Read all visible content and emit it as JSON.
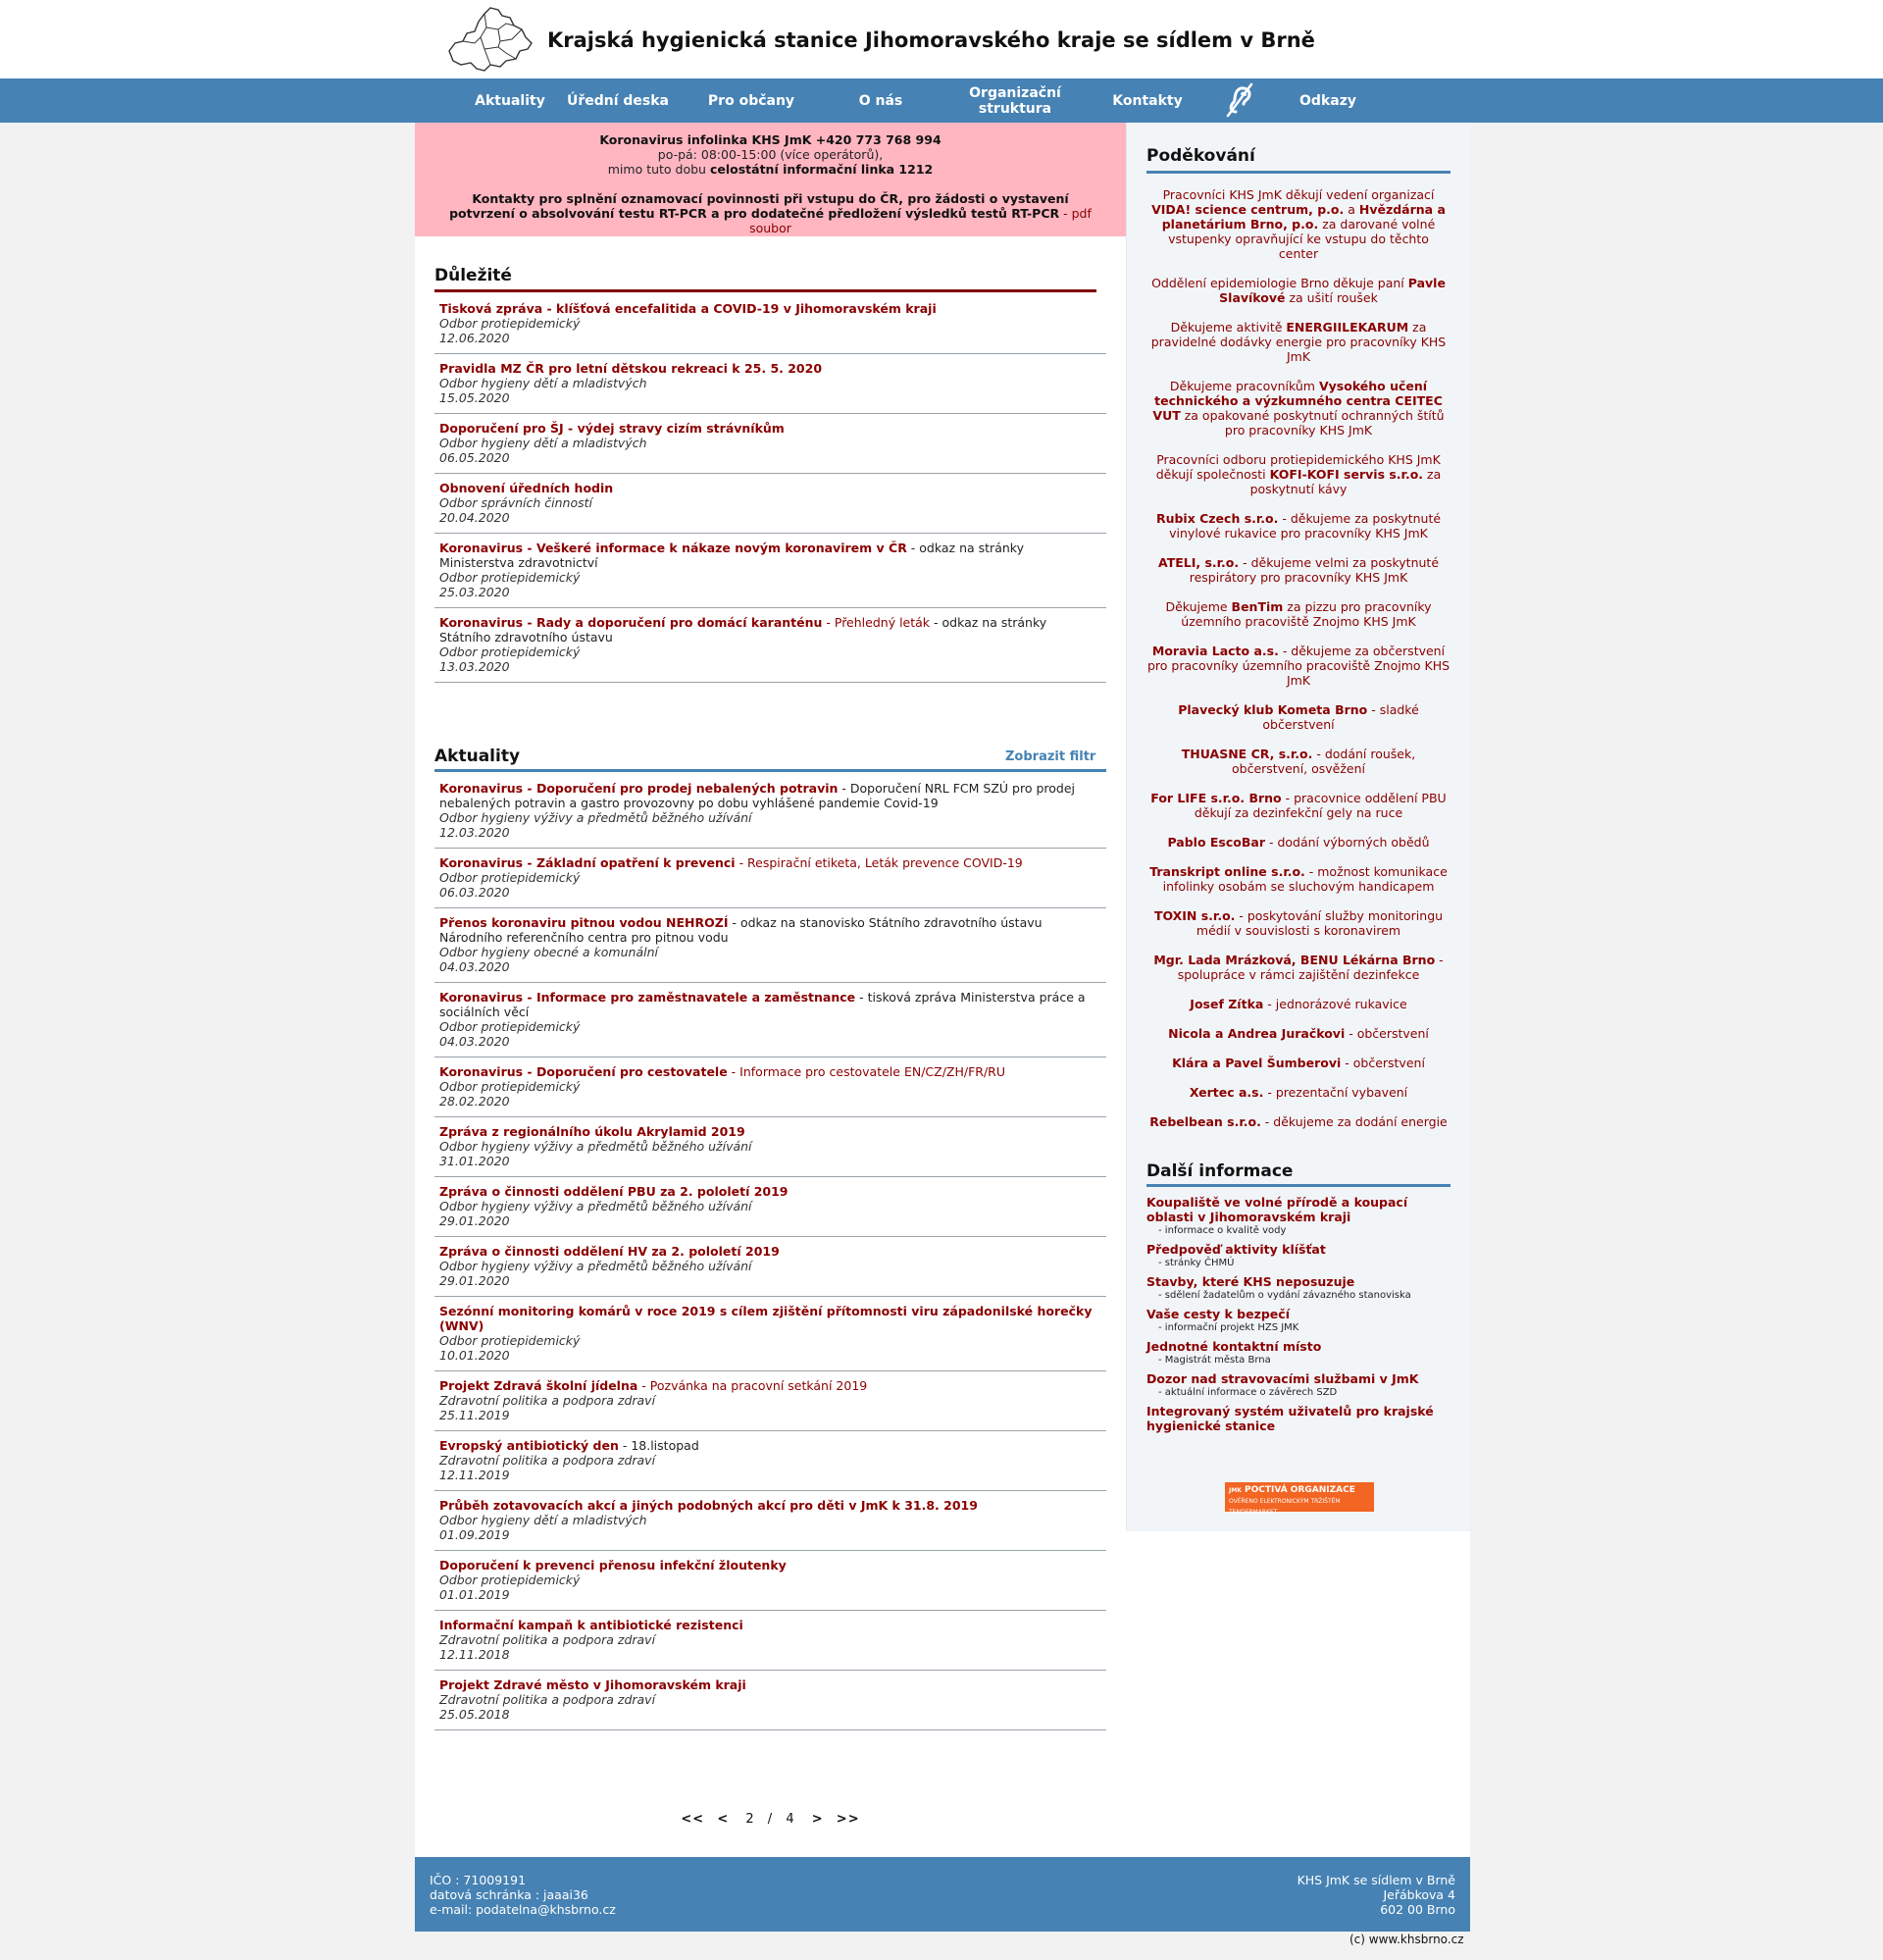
{
  "header": {
    "title": "Krajská hygienická stanice Jihomoravského kraje se sídlem v Brně",
    "logo_icon": "jmk-region-map-icon"
  },
  "nav": {
    "items": [
      {
        "label": "Aktuality"
      },
      {
        "label": "Úřední deska"
      },
      {
        "label": "Pro občany"
      },
      {
        "label": "O nás"
      },
      {
        "label": "Organizační struktura"
      },
      {
        "label": "Kontakty"
      },
      {
        "label": "Odkazy"
      }
    ],
    "hearing_icon": "hearing-aid-icon"
  },
  "alert": {
    "line1": "Koronavirus infolinka KHS JmK +420 773 768 994",
    "line2": "po-pá: 08:00-15:00 (více operátorů),",
    "line3_prefix": "mimo tuto dobu ",
    "line3_bold": "celostátní informační linka 1212",
    "contacts_bold": "Kontakty pro splnění oznamovací povinnosti při vstupu do ČR, pro žádosti o vystavení potvrzení o absolvování testu RT-PCR a pro dodatečné předložení výsledků testů RT-PCR",
    "contacts_link": " - pdf soubor"
  },
  "important": {
    "title": "Důležité",
    "items": [
      {
        "title": "Tisková zpráva - klíšťová encefalitida a COVID-19 v Jihomoravském kraji",
        "extra": "",
        "desc": "",
        "dept": "Odbor protiepidemický",
        "date": "12.06.2020"
      },
      {
        "title": "Pravidla MZ ČR pro letní dětskou rekreaci k 25. 5. 2020",
        "extra": "",
        "desc": "",
        "dept": "Odbor hygieny dětí a mladistvých",
        "date": "15.05.2020"
      },
      {
        "title": "Doporučení pro ŠJ - výdej stravy cizím strávníkům",
        "extra": "",
        "desc": "",
        "dept": "Odbor hygieny dětí a mladistvých",
        "date": "06.05.2020"
      },
      {
        "title": "Obnovení úředních hodin",
        "extra": "",
        "desc": "",
        "dept": "Odbor správních činností",
        "date": "20.04.2020"
      },
      {
        "title": "Koronavirus - Veškeré informace k nákaze novým koronavirem v ČR",
        "extra": "",
        "desc": " - odkaz na stránky Ministerstva zdravotnictví",
        "dept": "Odbor protiepidemický",
        "date": "25.03.2020"
      },
      {
        "title": "Koronavirus - Rady a doporučení pro domácí karanténu",
        "extra": " - Přehledný leták",
        "desc": " - odkaz na stránky Státního zdravotního ústavu",
        "dept": "Odbor protiepidemický",
        "date": "13.03.2020"
      }
    ]
  },
  "news": {
    "title": "Aktuality",
    "filter_label": "Zobrazit filtr",
    "items": [
      {
        "title": "Koronavirus - Doporučení pro prodej nebalených potravin",
        "extra": "",
        "desc": " - Doporučení NRL FCM SZÚ pro prodej nebalených potravin a gastro provozovny po dobu vyhlášené pandemie Covid-19",
        "dept": "Odbor hygieny výživy a předmětů běžného užívání",
        "date": "12.03.2020"
      },
      {
        "title": "Koronavirus - Základní opatření k prevenci",
        "extra": " - Respirační etiketa, Leták prevence COVID-19",
        "desc": "",
        "dept": "Odbor protiepidemický",
        "date": "06.03.2020"
      },
      {
        "title": "Přenos koronaviru pitnou vodou NEHROZÍ",
        "extra": "",
        "desc": " - odkaz na stanovisko Státního zdravotního ústavu Národního referenčního centra pro pitnou vodu",
        "dept": "Odbor hygieny obecné a komunální",
        "date": "04.03.2020"
      },
      {
        "title": "Koronavirus - Informace pro zaměstnavatele a zaměstnance",
        "extra": "",
        "desc": " - tisková zpráva Ministerstva práce a sociálních věcí",
        "dept": "Odbor protiepidemický",
        "date": "04.03.2020"
      },
      {
        "title": "Koronavirus - Doporučení pro cestovatele",
        "extra": " - Informace pro cestovatele EN/CZ/ZH/FR/RU",
        "desc": "",
        "dept": "Odbor protiepidemický",
        "date": "28.02.2020"
      },
      {
        "title": "Zpráva z regionálního úkolu Akrylamid 2019",
        "extra": "",
        "desc": "",
        "dept": "Odbor hygieny výživy a předmětů běžného užívání",
        "date": "31.01.2020"
      },
      {
        "title": "Zpráva o činnosti oddělení PBU za 2. pololetí 2019",
        "extra": "",
        "desc": "",
        "dept": "Odbor hygieny výživy a předmětů běžného užívání",
        "date": "29.01.2020"
      },
      {
        "title": "Zpráva o činnosti oddělení HV za 2. pololetí 2019",
        "extra": "",
        "desc": "",
        "dept": "Odbor hygieny výživy a předmětů běžného užívání",
        "date": "29.01.2020"
      },
      {
        "title": "Sezónní monitoring komárů v roce 2019 s cílem zjištění přítomnosti viru západonilské horečky (WNV)",
        "extra": "",
        "desc": "",
        "dept": "Odbor protiepidemický",
        "date": "10.01.2020"
      },
      {
        "title": "Projekt Zdravá školní jídelna",
        "extra": " - Pozvánka na pracovní setkání 2019",
        "desc": "",
        "dept": "Zdravotní politika a podpora zdraví",
        "date": "25.11.2019"
      },
      {
        "title": "Evropský antibiotický den",
        "extra": "",
        "desc": " - 18.listopad",
        "dept": "Zdravotní politika a podpora zdraví",
        "date": "12.11.2019"
      },
      {
        "title": "Průběh zotavovacích akcí a jiných podobných akcí pro děti v JmK k 31.8. 2019",
        "extra": "",
        "desc": "",
        "dept": "Odbor hygieny dětí a mladistvých",
        "date": "01.09.2019"
      },
      {
        "title": "Doporučení k prevenci přenosu infekční žloutenky",
        "extra": "",
        "desc": "",
        "dept": "Odbor protiepidemický",
        "date": "01.01.2019"
      },
      {
        "title": "Informační kampaň k antibiotické rezistenci",
        "extra": "",
        "desc": "",
        "dept": "Zdravotní politika a podpora zdraví",
        "date": "12.11.2018"
      },
      {
        "title": "Projekt Zdravé město v Jihomoravském kraji",
        "extra": "",
        "desc": "",
        "dept": "Zdravotní politika a podpora zdraví",
        "date": "25.05.2018"
      }
    ]
  },
  "pager": {
    "first": "<<",
    "prev": "<",
    "current": "2",
    "separator": "/",
    "total": "4",
    "next": ">",
    "last": ">>"
  },
  "thanks": {
    "title": "Poděkování",
    "items": [
      {
        "pre": "Pracovníci KHS JmK děkují vedení organizací ",
        "bold": "VIDA! science centrum, p.o.",
        "mid": " a ",
        "bold2": "Hvězdárna a planetárium Brno, p.o.",
        "post": " za darované volné vstupenky opravňující ke vstupu do těchto center"
      },
      {
        "pre": "Oddělení epidemiologie Brno děkuje paní ",
        "bold": "Pavle Slavíkové",
        "mid": "",
        "bold2": "",
        "post": " za ušití roušek"
      },
      {
        "pre": "Děkujeme aktivitě ",
        "bold": "ENERGIILEKARUM",
        "mid": "",
        "bold2": "",
        "post": " za pravidelné dodávky energie pro pracovníky KHS JmK"
      },
      {
        "pre": "Děkujeme pracovníkům ",
        "bold": "Vysokého učení technického a výzkumného centra CEITEC VUT",
        "mid": "",
        "bold2": "",
        "post": " za opakované poskytnutí ochranných štítů pro pracovníky KHS JmK"
      },
      {
        "pre": "Pracovníci odboru protiepidemického KHS JmK děkují společnosti ",
        "bold": "KOFI-KOFI servis s.r.o.",
        "mid": "",
        "bold2": "",
        "post": " za poskytnutí kávy"
      },
      {
        "pre": "",
        "bold": "Rubix Czech s.r.o.",
        "mid": "",
        "bold2": "",
        "post": " - děkujeme za poskytnuté vinylové rukavice pro pracovníky KHS JmK"
      },
      {
        "pre": "",
        "bold": "ATELI, s.r.o.",
        "mid": "",
        "bold2": "",
        "post": " - děkujeme velmi za poskytnuté respirátory pro pracovníky KHS JmK"
      },
      {
        "pre": "Děkujeme ",
        "bold": "BenTim",
        "mid": "",
        "bold2": "",
        "post": " za pizzu pro pracovníky územního pracoviště Znojmo KHS JmK"
      },
      {
        "pre": "",
        "bold": "Moravia Lacto a.s.",
        "mid": "",
        "bold2": "",
        "post": " - děkujeme za občerstvení pro pracovníky územního pracoviště Znojmo KHS JmK"
      },
      {
        "pre": "",
        "bold": "Plavecký klub Kometa Brno",
        "mid": "",
        "bold2": "",
        "post": " - sladké občerstvení"
      },
      {
        "pre": "",
        "bold": "THUASNE CR, s.r.o.",
        "mid": "",
        "bold2": "",
        "post": " - dodání roušek, občerstvení, osvěžení"
      },
      {
        "pre": "",
        "bold": "For LIFE s.r.o. Brno",
        "mid": "",
        "bold2": "",
        "post": " - pracovnice oddělení PBU děkují za dezinfekční gely na ruce"
      },
      {
        "pre": "",
        "bold": "Pablo EscoBar",
        "mid": "",
        "bold2": "",
        "post": " - dodání výborných obědů"
      },
      {
        "pre": "",
        "bold": "Transkript online s.r.o.",
        "mid": "",
        "bold2": "",
        "post": " - možnost komunikace infolinky osobám se sluchovým handicapem"
      },
      {
        "pre": "",
        "bold": "TOXIN s.r.o.",
        "mid": "",
        "bold2": "",
        "post": " - poskytování služby monitoringu médií v souvislosti s koronavirem"
      },
      {
        "pre": "",
        "bold": "Mgr. Lada Mrázková, BENU Lékárna Brno",
        "mid": "",
        "bold2": "",
        "post": " - spolupráce v rámci zajištění dezinfekce"
      },
      {
        "pre": "",
        "bold": "Josef Zítka",
        "mid": "",
        "bold2": "",
        "post": " - jednorázové rukavice"
      },
      {
        "pre": "",
        "bold": "Nicola a Andrea Juračkovi",
        "mid": "",
        "bold2": "",
        "post": " - občerstvení"
      },
      {
        "pre": "",
        "bold": "Klára a Pavel Šumberovi",
        "mid": "",
        "bold2": "",
        "post": " - občerstvení"
      },
      {
        "pre": "",
        "bold": "Xertec a.s.",
        "mid": "",
        "bold2": "",
        "post": " - prezentační vybavení"
      },
      {
        "pre": "",
        "bold": "Rebelbean s.r.o.",
        "mid": "",
        "bold2": "",
        "post": " - děkujeme za dodání energie"
      }
    ]
  },
  "more": {
    "title": "Další informace",
    "items": [
      {
        "link": "Koupaliště ve volné přírodě a koupací oblasti v Jihomoravském kraji",
        "note": "- informace o kvalitě vody"
      },
      {
        "link": "Předpověď aktivity klíšťat",
        "note": "- stránky ČHMÚ"
      },
      {
        "link": "Stavby, které KHS neposuzuje",
        "note": "- sdělení žadatelům o vydání závazného stanoviska"
      },
      {
        "link": "Vaše cesty k bezpečí",
        "note": "- informační projekt HZS JMK"
      },
      {
        "link": "Jednotné kontaktní místo",
        "note": "- Magistrát města Brna"
      },
      {
        "link": "Dozor nad stravovacími službami v JmK",
        "note": "- aktuální informace o závěrech SZD"
      },
      {
        "link": "Integrovaný systém uživatelů pro krajské hygienické stanice",
        "note": ""
      }
    ],
    "badge_title": "POCTIVÁ ORGANIZACE",
    "badge_prefix": "JMK",
    "badge_sub": "OVĚŘENO ELEKTRONICKÝM TRŽIŠTĚM TENDERMARKET"
  },
  "footer": {
    "ico": "IČO : 71009191",
    "databox": "datová schránka : jaaai36",
    "email": "e-mail: podatelna@khsbrno.cz",
    "org": "KHS JmK se sídlem v Brně",
    "street": "Jeřábkova 4",
    "city": "602 00 Brno",
    "copyright": "(c) www.khsbrno.cz"
  },
  "colors": {
    "nav": "#4682b4",
    "alert_bg": "#ffb6c1",
    "link": "#8b0000",
    "important_rule": "#800000",
    "news_rule": "#4682b4"
  }
}
